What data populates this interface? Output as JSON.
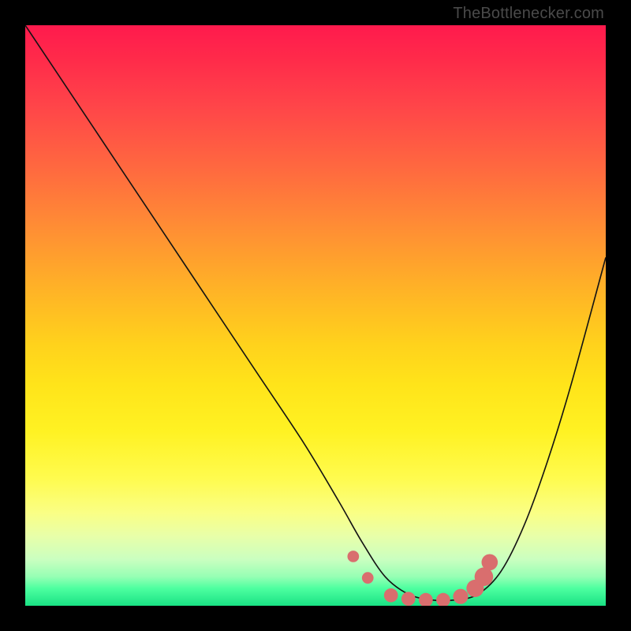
{
  "attribution": {
    "text": "TheBottlenecker.com"
  },
  "colors": {
    "curve_stroke": "#131313",
    "marker_fill": "#d96e6e",
    "frame": "#000000"
  },
  "chart_data": {
    "type": "line",
    "title": "",
    "xlabel": "",
    "ylabel": "",
    "xlim": [
      0,
      100
    ],
    "ylim": [
      0,
      100
    ],
    "series": [
      {
        "name": "bottleneck-curve",
        "x": [
          0,
          8,
          16,
          24,
          32,
          40,
          48,
          54,
          58,
          62,
          66,
          70,
          74,
          78,
          82,
          86,
          90,
          94,
          100
        ],
        "y": [
          100,
          88,
          76,
          64,
          52,
          40,
          28,
          18,
          11,
          5,
          2,
          1,
          1,
          2,
          6,
          14,
          25,
          38,
          60
        ]
      }
    ],
    "markers": [
      {
        "x": 56.5,
        "y": 8.5,
        "r": 1.0,
        "label": "left-edge-dot"
      },
      {
        "x": 59.0,
        "y": 4.8,
        "r": 1.0,
        "label": "left-inner-dot"
      },
      {
        "x": 63.0,
        "y": 1.8,
        "r": 1.2,
        "label": "floor-1"
      },
      {
        "x": 66.0,
        "y": 1.2,
        "r": 1.2,
        "label": "floor-2"
      },
      {
        "x": 69.0,
        "y": 1.0,
        "r": 1.2,
        "label": "floor-3"
      },
      {
        "x": 72.0,
        "y": 1.0,
        "r": 1.2,
        "label": "floor-4"
      },
      {
        "x": 75.0,
        "y": 1.6,
        "r": 1.3,
        "label": "floor-5"
      },
      {
        "x": 77.5,
        "y": 3.0,
        "r": 1.5,
        "label": "right-cluster-1"
      },
      {
        "x": 79.0,
        "y": 5.0,
        "r": 1.6,
        "label": "right-cluster-2"
      },
      {
        "x": 80.0,
        "y": 7.5,
        "r": 1.4,
        "label": "right-cluster-3"
      }
    ],
    "background_gradient_note": "vertical rainbow red→green indicates bottleneck severity; no numeric axis ticks visible"
  }
}
